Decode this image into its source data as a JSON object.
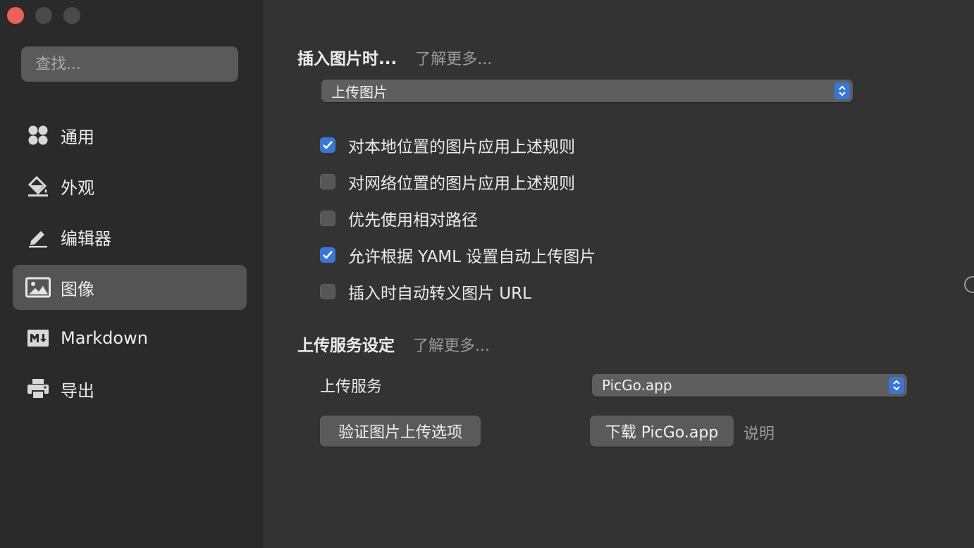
{
  "window": {
    "controls": [
      "close",
      "minimize",
      "maximize"
    ]
  },
  "sidebar": {
    "search_placeholder": "查找...",
    "items": [
      {
        "label": "通用",
        "icon": "grid-dots-icon",
        "active": false
      },
      {
        "label": "外观",
        "icon": "paint-bucket-icon",
        "active": false
      },
      {
        "label": "编辑器",
        "icon": "pencil-icon",
        "active": false
      },
      {
        "label": "图像",
        "icon": "image-icon",
        "active": true
      },
      {
        "label": "Markdown",
        "icon": "markdown-icon",
        "active": false
      },
      {
        "label": "导出",
        "icon": "printer-icon",
        "active": false
      }
    ]
  },
  "insert_section": {
    "title": "插入图片时...",
    "learn_more": "了解更多...",
    "action_select": "上传图片",
    "options": [
      {
        "label": "对本地位置的图片应用上述规则",
        "checked": true
      },
      {
        "label": "对网络位置的图片应用上述规则",
        "checked": false
      },
      {
        "label": "优先使用相对路径",
        "checked": false
      },
      {
        "label": "允许根据 YAML 设置自动上传图片",
        "checked": true
      },
      {
        "label": "插入时自动转义图片 URL",
        "checked": false
      }
    ]
  },
  "upload_section": {
    "title": "上传服务设定",
    "learn_more": "了解更多...",
    "service_label": "上传服务",
    "service_select": "PicGo.app",
    "verify_button": "验证图片上传选项",
    "download_button": "下载 PicGo.app",
    "help_link": "说明"
  },
  "colors": {
    "accent": "#3a76d6",
    "close": "#ee5f57",
    "sidebar_bg": "#2a2a2a",
    "main_bg": "#333333"
  }
}
